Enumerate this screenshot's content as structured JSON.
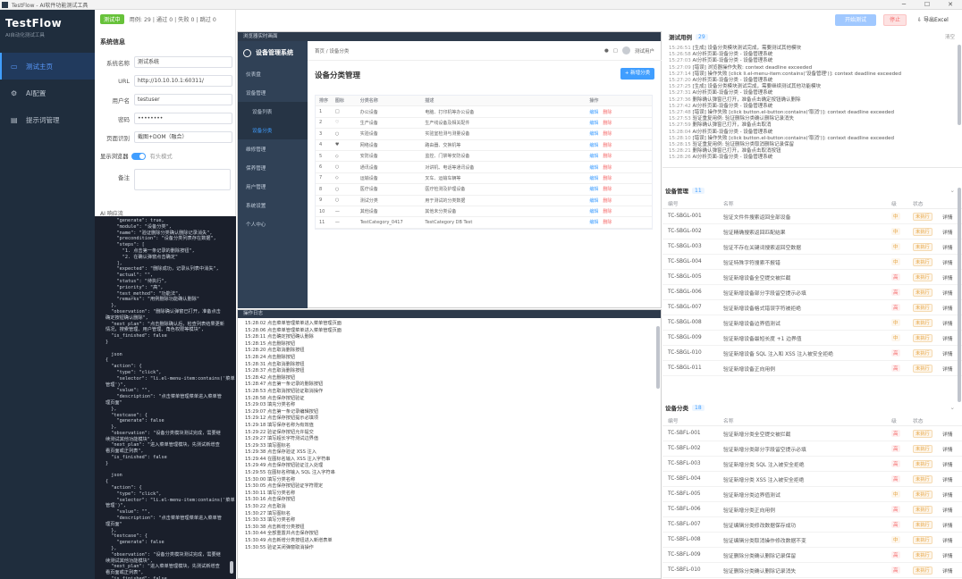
{
  "window": {
    "title": "TestFlow - AI软件功能测试工具",
    "controls": [
      "─",
      "☐",
      "✕"
    ]
  },
  "brand": {
    "name": "TestFlow",
    "subtitle": "AI自动化测试工具"
  },
  "nav": [
    {
      "label": "测试主页",
      "icon": "monitor-icon"
    },
    {
      "label": "AI配置",
      "icon": "settings-icon"
    },
    {
      "label": "提示词管理",
      "icon": "document-icon"
    }
  ],
  "status": {
    "badge": "测试中",
    "counts": "用例: 29 | 通过 0 | 失败 0 | 跳过 0"
  },
  "actions": {
    "start": "开始测试",
    "stop": "停止",
    "export": "导出Excel"
  },
  "sysinfo": {
    "title": "系统信息",
    "name_label": "系统名称",
    "name_value": "测试系统",
    "url_label": "URL",
    "url_value": "http://10.10.10.1:60311/",
    "user_label": "用户名",
    "user_value": "testuser",
    "pwd_label": "密码",
    "pwd_value": "••••••••",
    "mode_label": "页面识别",
    "mode_value": "截图+DOM（融合）",
    "browser_label": "显示浏览器",
    "browser_hint": "有头模式",
    "note_label": "备注"
  },
  "ai_label": "AI 响应流",
  "code_lines": [
    "    \"generate\": true,",
    "    \"module\": \"设备分类\",",
    "    \"name\": \"验证删除分类确认删除记录消失\",",
    "    \"precondition\": \"设备分类列表存在数据\",",
    "    \"steps\": [",
    "      \"1. 点击第一条记录的删除按钮\",",
    "      \"2. 在确认弹窗点击确定\"",
    "    ],",
    "    \"expected\": \"删除成功，记录从列表中消失\",",
    "    \"actual\": \"\",",
    "    \"status\": \"待执行\",",
    "    \"priority\": \"高\",",
    "    \"test_method\": \"功能法\",",
    "    \"remarks\": \"用例删除功能确认删除\"",
    "  },",
    "  \"observation\": \"删除确认弹窗已打开，准备点击",
    "确定按钮确认删除\",",
    "  \"next_plan\": \"点击删除确认后，检查列表结果更新",
    "情况，搜索管理、用户管理、角色权限等模块\",",
    "  \"is_finished\": false",
    "}",
    "",
    "  json",
    "{",
    "  \"action\": {",
    "    \"type\": \"click\",",
    "    \"selector\": \"li.el-menu-item:contains('菜单",
    "管理')\",",
    "    \"value\": \"\",",
    "    \"description\": \"点击菜单管理菜单进入菜单管",
    "理页面\"",
    "  },",
    "  \"testcase\": {",
    "    \"generate\": false",
    "  },",
    "  \"observation\": \"设备分类模块测试完成，需要继",
    "续测试其他功能模块\",",
    "  \"next_plan\": \"进入菜单管理模块，先测试新增查",
    "看页面或正列表\",",
    "  \"is_finished\": false",
    "}",
    "",
    "  json",
    "{",
    "  \"action\": {",
    "    \"type\": \"click\",",
    "    \"selector\": \"li.el-menu-item:contains('菜单",
    "管理')\",",
    "    \"value\": \"\",",
    "    \"description\": \"点击菜单管理菜单进入菜单管",
    "理页面\"",
    "  },",
    "  \"testcase\": {",
    "    \"generate\": false",
    "  },",
    "  \"observation\": \"设备分类模块测试完成，需要继",
    "续测试其他功能模块\",",
    "  \"next_plan\": \"进入菜单管理模块，先测试新增查",
    "看页面或正列表\",",
    "  \"is_finished\": false",
    "}"
  ],
  "preview": {
    "bar": "浏览器实时画面",
    "logo": "设备管理系统",
    "menu": [
      {
        "label": "仪表盘",
        "type": "m"
      },
      {
        "label": "设备管理",
        "type": "m"
      },
      {
        "label": "设备列表",
        "type": "sub"
      },
      {
        "label": "设备分类",
        "type": "sub sel"
      },
      {
        "label": "维修管理",
        "type": "m"
      },
      {
        "label": "保养管理",
        "type": "m"
      },
      {
        "label": "用户管理",
        "type": "m"
      },
      {
        "label": "系统设置",
        "type": "m"
      },
      {
        "label": "个人中心",
        "type": "m"
      }
    ],
    "breadcrumb": "首页 / 设备分类",
    "user": "测试用户",
    "page_title": "设备分类管理",
    "add_btn": "+ 新增分类",
    "headers": [
      "排序",
      "图标",
      "分类名称",
      "描述",
      "操作"
    ],
    "rows": [
      [
        "1",
        "□",
        "办公设备",
        "电脑、打印机等办公设备"
      ],
      [
        "2",
        "♡",
        "生产设备",
        "生产线设备及相关配件"
      ],
      [
        "3",
        "○",
        "实验设备",
        "实验室检测与测量设备"
      ],
      [
        "4",
        "♥",
        "网络设备",
        "路由器、交换机等"
      ],
      [
        "5",
        "◇",
        "安防设备",
        "监控、门禁等安防设备"
      ],
      [
        "6",
        "○",
        "通讯设备",
        "对讲机、电话等通讯设备"
      ],
      [
        "7",
        "◇",
        "运输设备",
        "叉车、运输车辆等"
      ],
      [
        "8",
        "○",
        "医疗设备",
        "医疗检测及护理设备"
      ],
      [
        "9",
        "○",
        "测试分类",
        "用于测试的分类数据"
      ],
      [
        "10",
        "—",
        "其他设备",
        "其他未分类设备"
      ],
      [
        "11",
        "—",
        "TestCategory_0417",
        "TestCategory DB Test"
      ]
    ],
    "op_edit": "编辑",
    "op_del": "删除"
  },
  "exec_log": {
    "title": "操作日志",
    "lines": [
      "15:28:02 点击菜单管理菜单进入菜单管理页面",
      "15:28:06 点击菜单管理菜单进入菜单管理页面",
      "15:28:11 点击确定按钮确认删除",
      "15:28:15 点击删除按钮",
      "15:28:20 点击取消删除按钮",
      "15:28:24 点击删除按钮",
      "15:28:31 点击取消删除按钮",
      "15:28:37 点击取消删除按钮",
      "15:28:42 点击删除按钮",
      "15:28:47 点击第一条记录的删除按钮",
      "15:28:53 点击取消按钮验证取消操作",
      "15:28:58 点击保存按钮验证",
      "15:29:03 填充分类名称",
      "15:29:07 点击第一条记录编辑按钮",
      "15:29:12 点击保存按钮提示必填项",
      "15:29:18 填写保存名称为有效值",
      "15:29:22 验证保存按钮允许提交",
      "15:29:27 填写超长字符测试边界值",
      "15:29:33 填写图标名",
      "15:29:38 点击保存验证 XSS 注入",
      "15:29:44 在图标名输入 XSS 注入字符串",
      "15:29:49 点击保存按钮验证注入处理",
      "15:29:55 在图标名称输入 SQL 注入字符串",
      "15:30:00 填写分类名称",
      "15:30:05 点击保存按钮验证字符限定",
      "15:30:11 填写分类名称",
      "15:30:16 点击保存按钮",
      "15:30:22 点击取消",
      "15:30:27 填写图标名",
      "15:30:33 填写分类名称",
      "15:30:38 点击新增分类按钮",
      "15:30:44 全部重置并点击保存按钮",
      "15:30:49 点击新增分类按钮进入新增表单",
      "15:30:55 验证关闭弹窗取消操作"
    ]
  },
  "test_log": {
    "title": "测试用例",
    "count": "29",
    "clear": "清空",
    "lines": [
      [
        "15:26:51",
        "[生成] 设备分类模块测试完成，需要测试其他模块"
      ],
      [
        "15:26:58",
        "AI分析页面-设备分类 - 设备管理系统"
      ],
      [
        "15:27:03",
        "AI分析页面-设备分类 - 设备管理系统"
      ],
      [
        "15:27:09",
        "[错误] 浏览器操作失败: context deadline exceeded"
      ],
      [
        "15:27:14",
        "[错误] 操作失败 [click li.el-menu-item:contains('设备管理')]: context deadline exceeded"
      ],
      [
        "15:27:20",
        "AI分析页面-设备分类 - 设备管理系统"
      ],
      [
        "15:27:25",
        "[生成] 设备分类模块测试完成，需要继续测试其他功能模块"
      ],
      [
        "15:27:31",
        "AI分析页面-设备分类 - 设备管理系统"
      ],
      [
        "15:27:36",
        "删除确认弹窗已打开，准备点击确定按钮确认删除"
      ],
      [
        "15:27:42",
        "AI分析页面-设备分类 - 设备管理系统"
      ],
      [
        "15:27:48",
        "[错误] 操作失败 [click button.el-button:contains('取消')]: context deadline exceeded"
      ],
      [
        "15:27:53",
        "验证重复用例: 验证删除分类确认删除记录消失"
      ],
      [
        "15:27:59",
        "删除确认弹窗已打开，准备点击取消"
      ],
      [
        "15:28:04",
        "AI分析页面-设备分类 - 设备管理系统"
      ],
      [
        "15:28:10",
        "[错误] 操作失败 [click button.el-button:contains('取消')]: context deadline exceeded"
      ],
      [
        "15:28:15",
        "验证重复用例: 验证删除分类取消删除记录保留"
      ],
      [
        "15:28:21",
        "删除确认弹窗已打开，准备点击取消按钮"
      ],
      [
        "15:28:26",
        "AI分析页面-设备分类 - 设备管理系统"
      ]
    ]
  },
  "section_device": {
    "title": "设备管理",
    "count": "11",
    "headers": [
      "编号",
      "名称",
      "级",
      "状态",
      ""
    ],
    "rows": [
      [
        "TC-SBGL-001",
        "验证文件件搜索返回全部设备",
        "中",
        "未执行",
        "详情"
      ],
      [
        "TC-SBGL-002",
        "验证精确搜索返回匹配结果",
        "中",
        "未执行",
        "详情"
      ],
      [
        "TC-SBGL-003",
        "验证不存在关键词搜索返回空数据",
        "中",
        "未执行",
        "详情"
      ],
      [
        "TC-SBGL-004",
        "验证特殊字符搜索不报错",
        "中",
        "未执行",
        "详情"
      ],
      [
        "TC-SBGL-005",
        "验证新增设备全空提交被拦截",
        "高",
        "未执行",
        "详情"
      ],
      [
        "TC-SBGL-006",
        "验证新增设备部分字段留空提示必填",
        "高",
        "未执行",
        "详情"
      ],
      [
        "TC-SBGL-007",
        "验证新增设备格式错误字符被拒绝",
        "高",
        "未执行",
        "详情"
      ],
      [
        "TC-SBGL-008",
        "验证新增设备边界值测试",
        "中",
        "未执行",
        "详情"
      ],
      [
        "TC-SBGL-009",
        "验证新增设备最短长度 +1 边界值",
        "中",
        "未执行",
        "详情"
      ],
      [
        "TC-SBGL-010",
        "验证新增设备 SQL 注入和 XSS 注入被安全拒绝",
        "高",
        "未执行",
        "详情"
      ],
      [
        "TC-SBGL-011",
        "验证新增设备正向用例",
        "高",
        "未执行",
        "详情"
      ]
    ]
  },
  "section_category": {
    "title": "设备分类",
    "count": "18",
    "headers": [
      "编号",
      "名称",
      "级",
      "状态",
      ""
    ],
    "rows": [
      [
        "TC-SBFL-001",
        "验证新增分类全空提交被拦截",
        "高",
        "未执行",
        "详情"
      ],
      [
        "TC-SBFL-002",
        "验证新增分类部分字段留空提示必填",
        "高",
        "未执行",
        "详情"
      ],
      [
        "TC-SBFL-003",
        "验证新增分类 SQL 注入被安全拒绝",
        "高",
        "未执行",
        "详情"
      ],
      [
        "TC-SBFL-004",
        "验证新增分类 XSS 注入被安全拒绝",
        "高",
        "未执行",
        "详情"
      ],
      [
        "TC-SBFL-005",
        "验证新增分类边界值测试",
        "中",
        "未执行",
        "详情"
      ],
      [
        "TC-SBFL-006",
        "验证新增分类正向用例",
        "高",
        "未执行",
        "详情"
      ],
      [
        "TC-SBFL-007",
        "验证编辑分类修改数据保存成功",
        "高",
        "未执行",
        "详情"
      ],
      [
        "TC-SBFL-008",
        "验证编辑分类取消操作修改数据不变",
        "中",
        "未执行",
        "详情"
      ],
      [
        "TC-SBFL-009",
        "验证删除分类确认删除记录保留",
        "高",
        "未执行",
        "详情"
      ],
      [
        "TC-SBFL-010",
        "验证删除分类确认删除记录消失",
        "高",
        "未执行",
        "详情"
      ]
    ]
  }
}
